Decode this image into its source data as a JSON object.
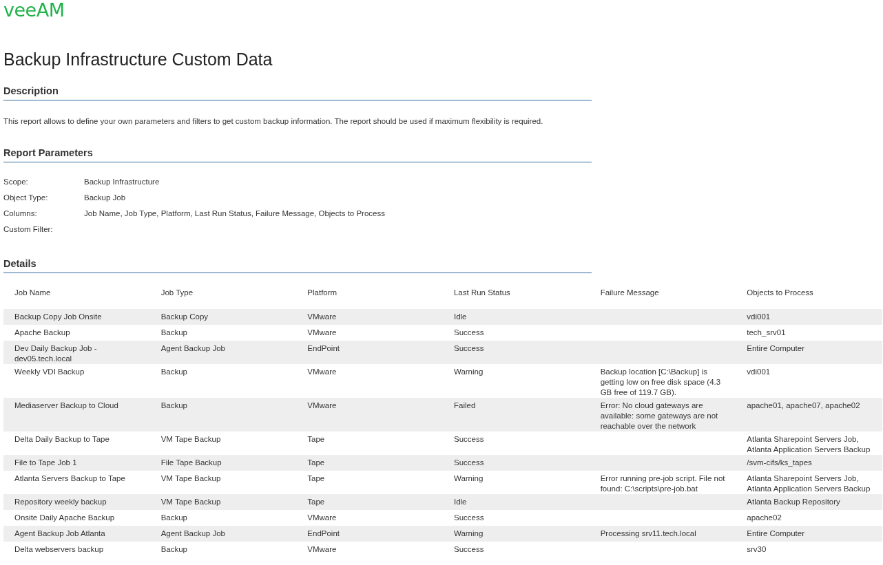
{
  "logo": "veeAM",
  "title": "Backup Infrastructure Custom Data",
  "description": {
    "heading": "Description",
    "text": "This report allows to define your own parameters and filters to get custom backup information. The report should be used if maximum flexibility is required."
  },
  "parameters": {
    "heading": "Report Parameters",
    "rows": [
      {
        "label": "Scope:",
        "value": "Backup Infrastructure"
      },
      {
        "label": "Object Type:",
        "value": "Backup Job"
      },
      {
        "label": "Columns:",
        "value": "Job Name, Job Type, Platform, Last Run Status, Failure Message, Objects to Process"
      },
      {
        "label": "Custom Filter:"
      }
    ]
  },
  "details": {
    "heading": "Details",
    "table": {
      "columns": [
        "Job Name",
        "Job Type",
        "Platform",
        "Last Run Status",
        "Failure Message",
        "Objects to Process"
      ],
      "rows": [
        {
          "job_name": "Backup Copy Job Onsite",
          "job_type": "Backup Copy",
          "platform": "VMware",
          "last_run_status": "Idle",
          "objects_to_process": "vdi001"
        },
        {
          "job_name": "Apache Backup",
          "job_type": "Backup",
          "platform": "VMware",
          "last_run_status": "Success",
          "objects_to_process": "tech_srv01"
        },
        {
          "job_name": "Dev Daily Backup Job - dev05.tech.local",
          "job_type": "Agent Backup Job",
          "platform": "EndPoint",
          "last_run_status": "Success",
          "objects_to_process": "Entire Computer"
        },
        {
          "job_name": "Weekly VDI Backup",
          "job_type": "Backup",
          "platform": "VMware",
          "last_run_status": "Warning",
          "failure_message": "Backup location [C:\\Backup] is getting low on free disk space (4.3 GB free of 119.7 GB).",
          "objects_to_process": "vdi001"
        },
        {
          "job_name": "Mediaserver Backup to Cloud",
          "job_type": "Backup",
          "platform": "VMware",
          "last_run_status": "Failed",
          "failure_message": "Error: No cloud gateways are available: some gateways are not reachable over the network",
          "objects_to_process": "apache01, apache07, apache02"
        },
        {
          "job_name": "Delta Daily Backup to Tape",
          "job_type": "VM Tape Backup",
          "platform": "Tape",
          "last_run_status": "Success",
          "objects_to_process": "Atlanta Sharepoint Servers Job, Atlanta Application Servers Backup"
        },
        {
          "job_name": "File to Tape Job 1",
          "job_type": "File Tape Backup",
          "platform": "Tape",
          "last_run_status": "Success",
          "objects_to_process": "/svm-cifs/ks_tapes"
        },
        {
          "job_name": "Atlanta Servers Backup to Tape",
          "job_type": "VM Tape Backup",
          "platform": "Tape",
          "last_run_status": "Warning",
          "failure_message": "Error running pre-job script. File not found: C:\\scripts\\pre-job.bat",
          "objects_to_process": "Atlanta Sharepoint Servers Job, Atlanta Application Servers Backup"
        },
        {
          "job_name": "Repository weekly backup",
          "job_type": "VM Tape Backup",
          "platform": "Tape",
          "last_run_status": "Idle",
          "objects_to_process": "Atlanta Backup Repository"
        },
        {
          "job_name": "Onsite Daily Apache Backup",
          "job_type": "Backup",
          "platform": "VMware",
          "last_run_status": "Success",
          "objects_to_process": "apache02"
        },
        {
          "job_name": "Agent Backup Job Atlanta",
          "job_type": "Agent Backup Job",
          "platform": "EndPoint",
          "last_run_status": "Warning",
          "failure_message": "Processing srv11.tech.local",
          "objects_to_process": "Entire Computer"
        },
        {
          "job_name": "Delta webservers backup",
          "job_type": "Backup",
          "platform": "VMware",
          "last_run_status": "Success",
          "objects_to_process": "srv30"
        }
      ]
    }
  }
}
